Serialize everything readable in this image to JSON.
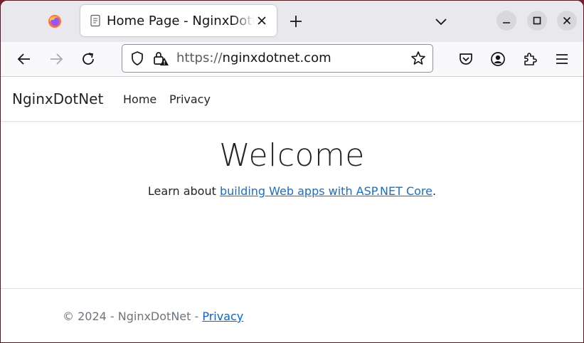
{
  "browser": {
    "tab": {
      "title": "Home Page - NginxDotNet"
    },
    "url": {
      "scheme": "https://",
      "host": "nginxdotnet.com"
    }
  },
  "site": {
    "brand": "NginxDotNet",
    "nav": {
      "home": "Home",
      "privacy": "Privacy"
    },
    "welcome": "Welcome",
    "learn": {
      "prefix": "Learn about ",
      "link": "building Web apps with ASP.NET Core",
      "suffix": "."
    },
    "footer": {
      "copyright": "© 2024 - NginxDotNet - ",
      "privacy": "Privacy"
    }
  },
  "icons": [
    "firefox-logo-icon",
    "page-icon",
    "close-icon",
    "plus-icon",
    "chevron-down-icon",
    "minimize-icon",
    "maximize-icon",
    "close-window-icon",
    "back-arrow-icon",
    "forward-arrow-icon",
    "reload-icon",
    "shield-icon",
    "lock-warning-icon",
    "star-icon",
    "pocket-icon",
    "account-icon",
    "extensions-icon",
    "menu-icon"
  ],
  "colors": {
    "link": "#1b6ec2",
    "footer_link": "#0366d6",
    "text": "#212529",
    "muted": "#6c757d"
  }
}
